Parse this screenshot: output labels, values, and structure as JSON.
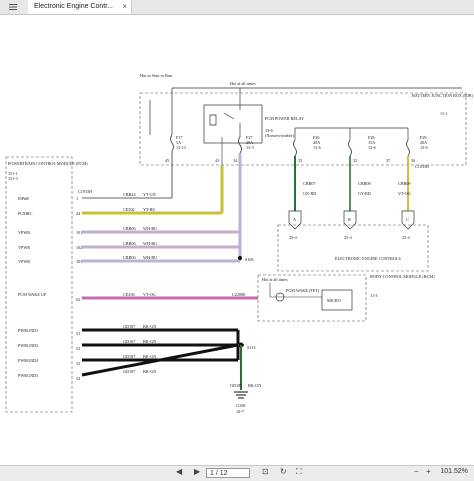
{
  "tab": {
    "title": "Electronic Engine Contr...",
    "close": "×"
  },
  "diagram": {
    "hot_start_run": "Hot in Start or Run",
    "hot_all_times": "Hot at all times",
    "bjb_title": "BATTERY JUNCTION BOX (BJB)",
    "bjb_ref": "11-1",
    "relay_title": "PCM POWER RELAY",
    "relay_ref": "13-6",
    "relay_note": "(Nonserviceable)",
    "fuses": [
      {
        "name": "F17",
        "rating": "5A",
        "ref": "13-13"
      },
      {
        "name": "F27",
        "rating": "20A",
        "ref": "13-3"
      },
      {
        "name": "F26",
        "rating": "20A",
        "ref": "13-6"
      },
      {
        "name": "F28",
        "rating": "15A",
        "ref": "13-6"
      },
      {
        "name": "F29",
        "rating": "20A",
        "ref": "13-6"
      }
    ],
    "bjb_pins": [
      "45",
      "41",
      "34",
      "33",
      "32",
      "37",
      "36"
    ],
    "c1035b": "C1035B",
    "pcm_title": "POWERTRAIN CONTROL MODULE (PCM)",
    "pcm_ref1": "151-1",
    "pcm_ref2": "151-3",
    "pcm_conn": "C1915H",
    "pcm_pins": [
      {
        "label": "ISPnR",
        "pin": "1"
      },
      {
        "label": "PCMRC",
        "pin": "44"
      },
      {
        "label": "VPWR",
        "pin": "101"
      },
      {
        "label": "VPWR",
        "pin": "102"
      },
      {
        "label": "VPWR",
        "pin": "103"
      },
      {
        "label": "PCM WAKE UP",
        "pin": "62"
      },
      {
        "label": "PWRGND1",
        "pin": "51"
      },
      {
        "label": "PWRGND2",
        "pin": "52"
      },
      {
        "label": "PWRGND4",
        "pin": "53"
      },
      {
        "label": "PWRGND3",
        "pin": "54"
      }
    ],
    "circuits": [
      {
        "id": "CBB24",
        "color": "YT-GN"
      },
      {
        "id": "CE502",
        "color": "YT-BU"
      },
      {
        "id": "CBB06",
        "color": "WH-BU"
      },
      {
        "id": "CBB06",
        "color": "WH-BU"
      },
      {
        "id": "CBB06",
        "color": "WH-BU"
      },
      {
        "id": "CE456",
        "color": "VT-OG"
      },
      {
        "id": "GD187",
        "color": "BK-GN"
      },
      {
        "id": "GD187",
        "color": "BK-GN"
      },
      {
        "id": "GD187",
        "color": "BK-GN"
      },
      {
        "id": "GD187",
        "color": "BK-GN"
      }
    ],
    "splice_s106": "S106",
    "splice_s113": "S113",
    "ground_wire": "GD187",
    "ground_color": "BK-GN",
    "ground_label": "G108",
    "ground_ref": "10-7",
    "bcm_title": "BODY CONTROL MODULE (BCM)",
    "bcm_ref": "11-3",
    "bcm_hot": "Hot at all times",
    "bcm_wake": "PCM WAKE (FET)",
    "bcm_micro": "MICRO",
    "bcm_conn": "C2280E",
    "eec_title": "ELECTRONIC ENGINE CONTROLS",
    "eec_out": [
      {
        "wire": "CBB07",
        "color": "GN-RD",
        "letter": "A",
        "ref": "25-4"
      },
      {
        "wire": "CBB08",
        "color": "GY-RD",
        "letter": "B",
        "ref": "25-4"
      },
      {
        "wire": "CBB09",
        "color": "VT-OG",
        "letter": "C",
        "ref": "25-4"
      }
    ]
  },
  "viewer": {
    "page_value": "1 / 12",
    "zoom": "101.52%",
    "colors": {
      "purple": "#b99bc9",
      "yellow": "#c8c03a",
      "pink": "#c86ab4",
      "green": "#2a6e3a",
      "black": "#111111",
      "lav": "#bfb1d6"
    }
  }
}
